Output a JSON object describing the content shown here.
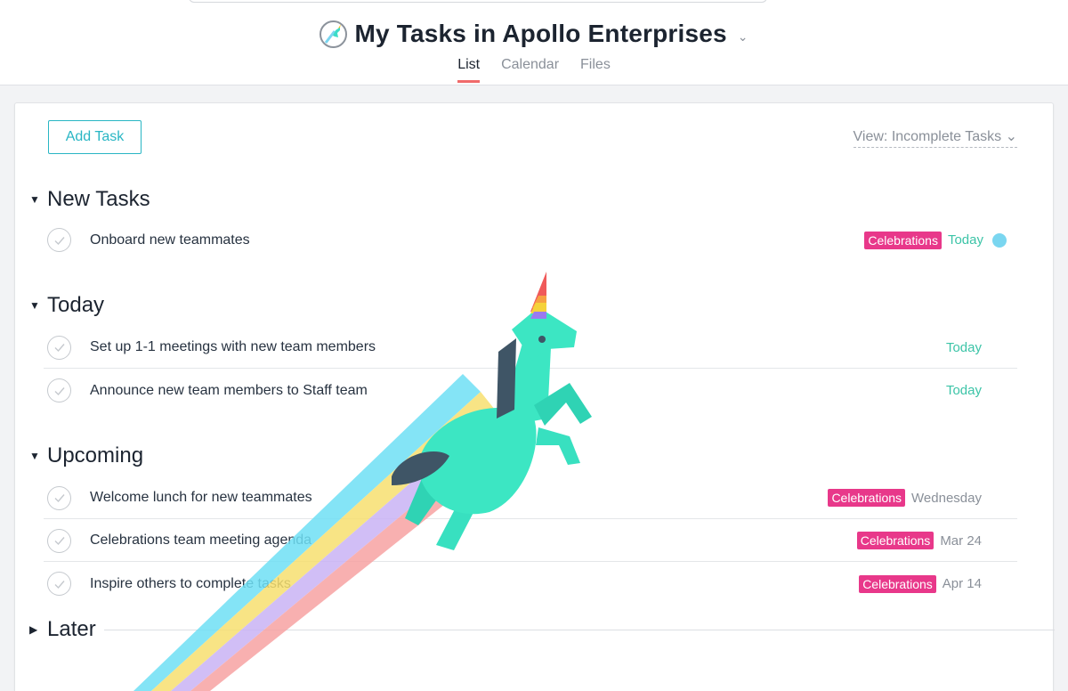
{
  "header": {
    "title": "My Tasks in Apollo Enterprises",
    "title_chevron": "⌄",
    "tabs": [
      {
        "label": "List",
        "active": true
      },
      {
        "label": "Calendar",
        "active": false
      },
      {
        "label": "Files",
        "active": false
      }
    ]
  },
  "toolbar": {
    "add_task_label": "Add Task",
    "view_label": "View: Incomplete Tasks",
    "view_chevron": "⌄"
  },
  "sections": [
    {
      "title": "New Tasks",
      "expanded": true,
      "tasks": [
        {
          "name": "Onboard new teammates",
          "tag": "Celebrations",
          "due": "Today",
          "due_style": "today",
          "has_assignee": true
        }
      ]
    },
    {
      "title": "Today",
      "expanded": true,
      "tasks": [
        {
          "name": "Set up 1-1 meetings with new team members",
          "tag": "",
          "due": "Today",
          "due_style": "today"
        },
        {
          "name": "Announce new team members to Staff team",
          "tag": "",
          "due": "Today",
          "due_style": "today"
        }
      ]
    },
    {
      "title": "Upcoming",
      "expanded": true,
      "tasks": [
        {
          "name": "Welcome lunch for new teammates",
          "tag": "Celebrations",
          "due": "Wednesday",
          "due_style": "normal"
        },
        {
          "name": "Celebrations team meeting agenda",
          "tag": "Celebrations",
          "due": "Mar 24",
          "due_style": "normal"
        },
        {
          "name": "Inspire others to complete tasks",
          "tag": "Celebrations",
          "due": "Apr 14",
          "due_style": "normal"
        }
      ]
    },
    {
      "title": "Later",
      "expanded": false,
      "tasks": []
    }
  ],
  "colors": {
    "accent": "#29b6c4",
    "tag": "#e8388a",
    "today": "#3cc4a7",
    "active_tab": "#f06a6a",
    "assignee": "#7ad6f0"
  },
  "icons": [
    "unicorn-icon",
    "dropdown-chevron-icon",
    "check-circle-icon",
    "caret-down-icon",
    "caret-right-icon"
  ]
}
